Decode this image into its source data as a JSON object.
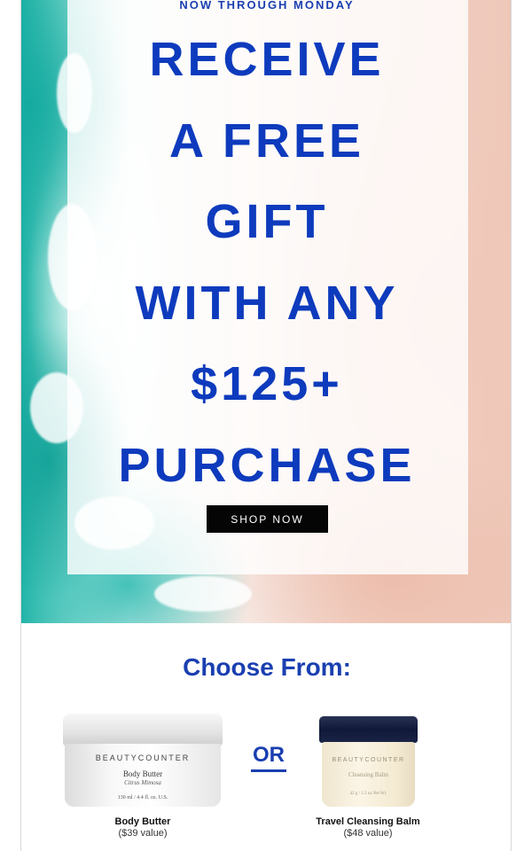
{
  "promo": {
    "eyebrow": "NOW THROUGH MONDAY",
    "headline_lines": [
      "RECEIVE",
      "A FREE",
      "GIFT",
      "WITH ANY",
      "$125+",
      "PURCHASE"
    ],
    "cta_label": "SHOP NOW"
  },
  "gift_section": {
    "heading": "Choose From:",
    "separator": "OR",
    "products": [
      {
        "name": "Body Butter",
        "value": "($39 value)",
        "package": {
          "brand": "BEAUTYCOUNTER",
          "product": "Body Butter",
          "scent": "Citrus Mimosa",
          "size": "130 ml / 4.4 fl. oz. U.S."
        }
      },
      {
        "name": "Travel Cleansing Balm",
        "value": "($48 value)",
        "package": {
          "brand": "BEAUTYCOUNTER",
          "product": "Cleansing Balm",
          "size": "42 g / 1.5 oz Net Wt."
        }
      }
    ]
  },
  "colors": {
    "brand_blue": "#0e3bbd",
    "button_black": "#050505",
    "sea_teal": "#1fb3a6",
    "sand_pink": "#f2d2c6"
  }
}
